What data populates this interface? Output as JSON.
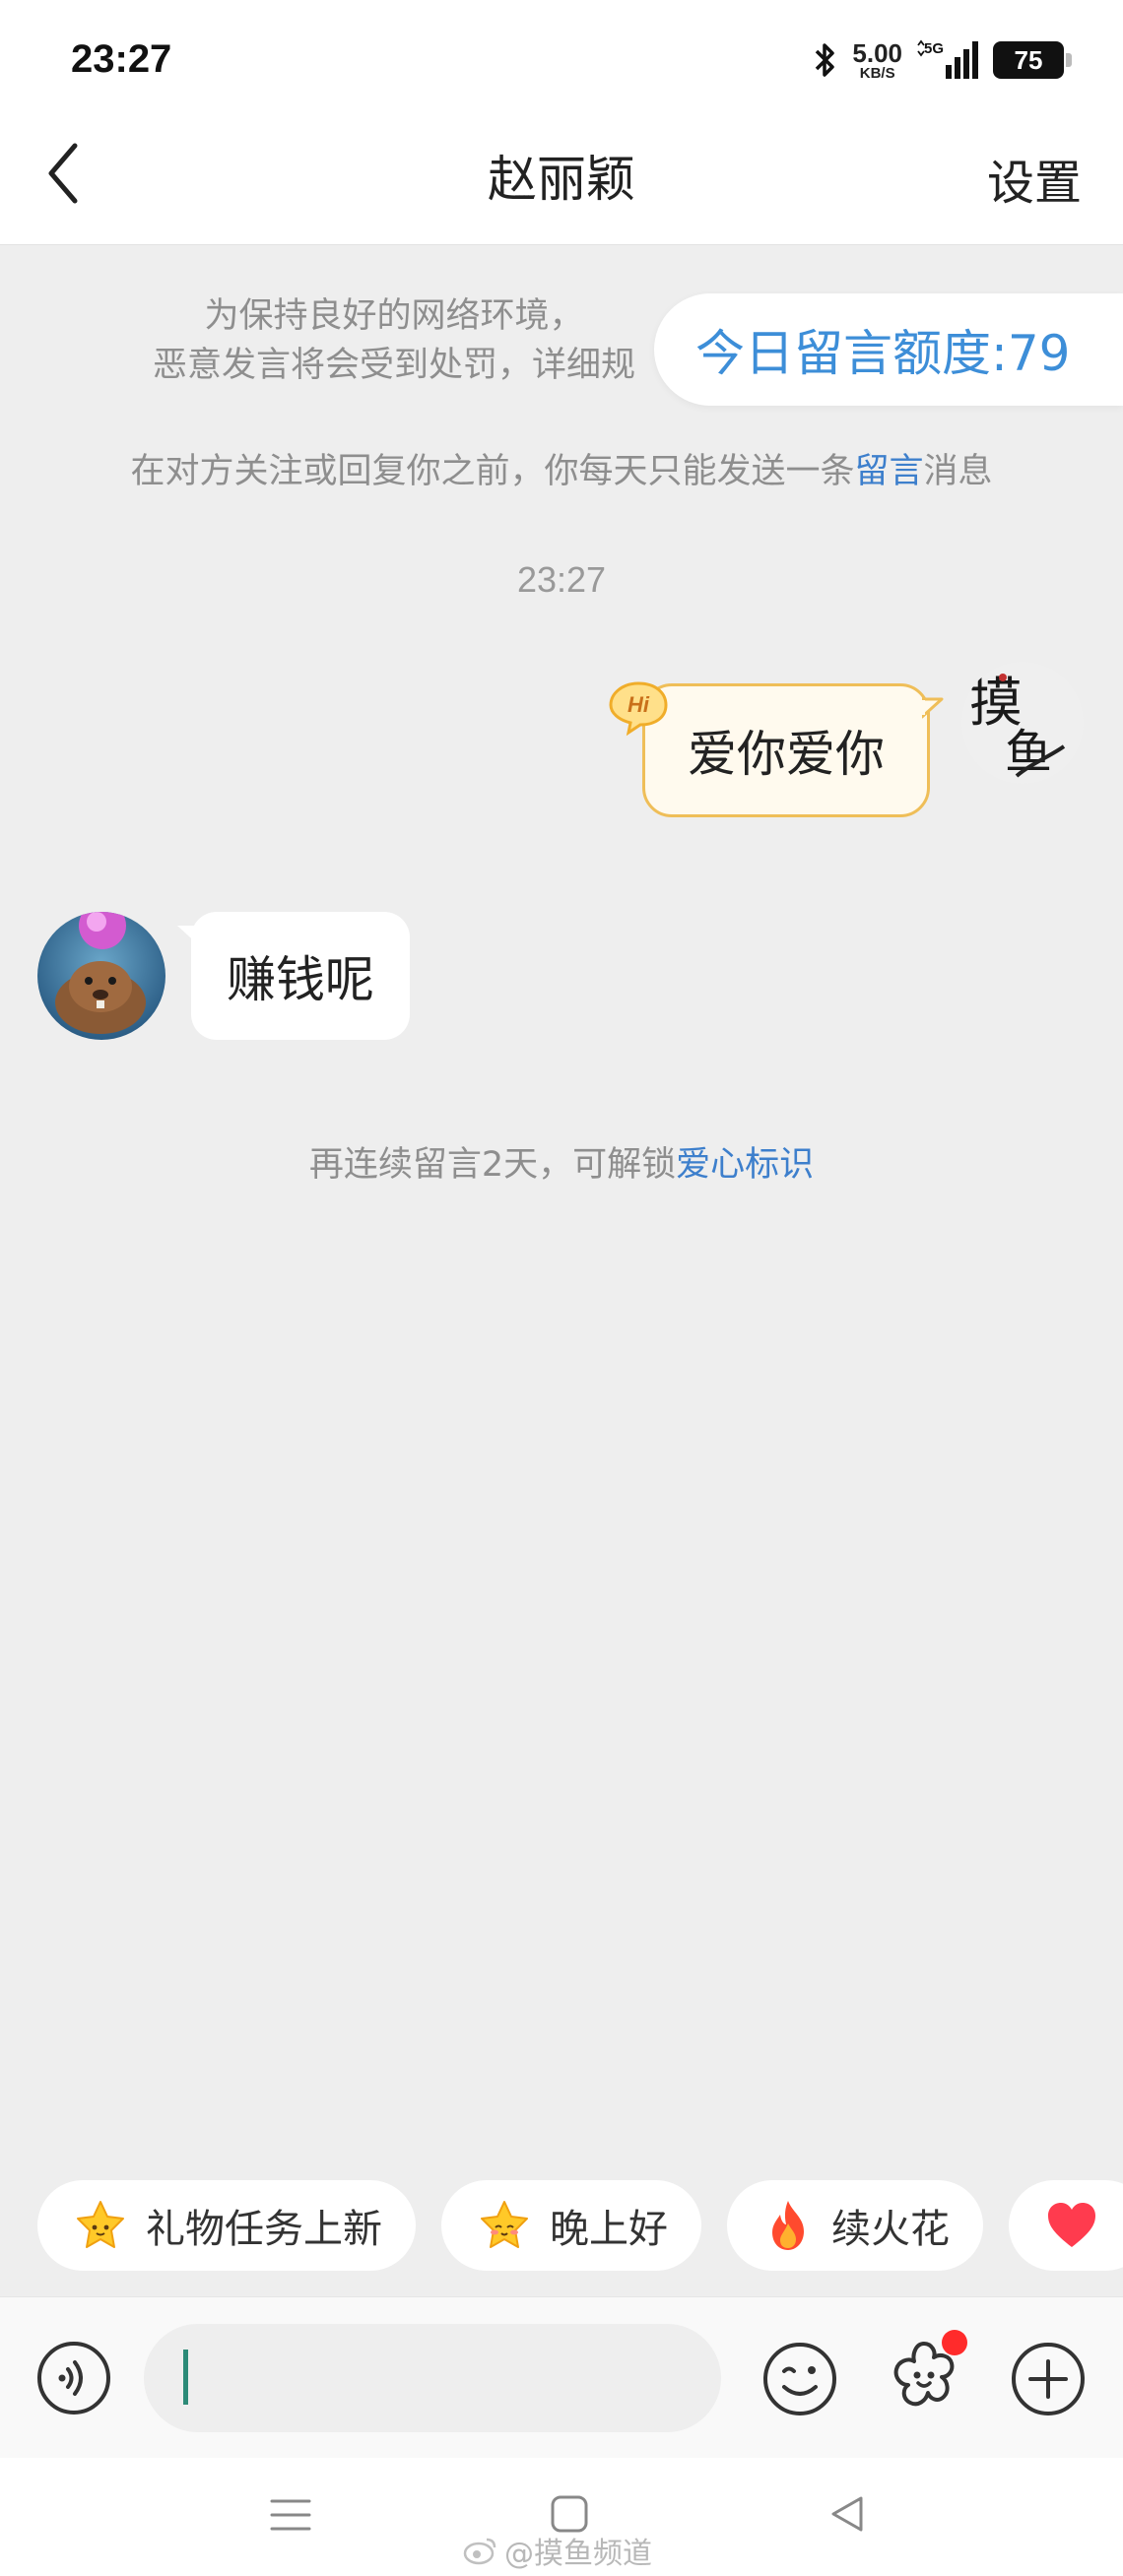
{
  "status_bar": {
    "time": "23:27",
    "net_speed_value": "5.00",
    "net_speed_unit": "KB/S",
    "network_type": "5G",
    "battery": "75"
  },
  "header": {
    "title": "赵丽颖",
    "settings_label": "设置"
  },
  "notices": {
    "rules_line1": "为保持良好的网络环境，",
    "rules_line2": "恶意发言将会受到处罚，详细规",
    "quota_label": "今日留言额度:79",
    "limit_prefix": "在对方关注或回复你之前，你每天只能发送一条",
    "limit_link": "留言",
    "limit_suffix": "消息"
  },
  "chat": {
    "timestamp": "23:27",
    "hi_badge": "Hi",
    "my_message": "爱你爱你",
    "my_avatar_text_1": "摸",
    "my_avatar_text_2": "鱼",
    "other_message": "赚钱呢",
    "unlock_prefix": "再连续留言2天，可解锁",
    "unlock_link": "爱心标识"
  },
  "quick_chips": [
    {
      "icon": "star-face-icon",
      "label": "礼物任务上新"
    },
    {
      "icon": "star-face-icon",
      "label": "晚上好"
    },
    {
      "icon": "fire-icon",
      "label": "续火花"
    },
    {
      "icon": "heart-icon",
      "label": ""
    }
  ],
  "input_bar": {
    "value": "",
    "icons": [
      "voice-icon",
      "emoji-icon",
      "flower-icon",
      "plus-icon"
    ]
  },
  "watermark": "@摸鱼频道",
  "colors": {
    "accent_blue": "#3d8ed8",
    "bubble_border": "#efbe58",
    "cursor": "#2c8a77",
    "badge_red": "#ff2b2b"
  }
}
